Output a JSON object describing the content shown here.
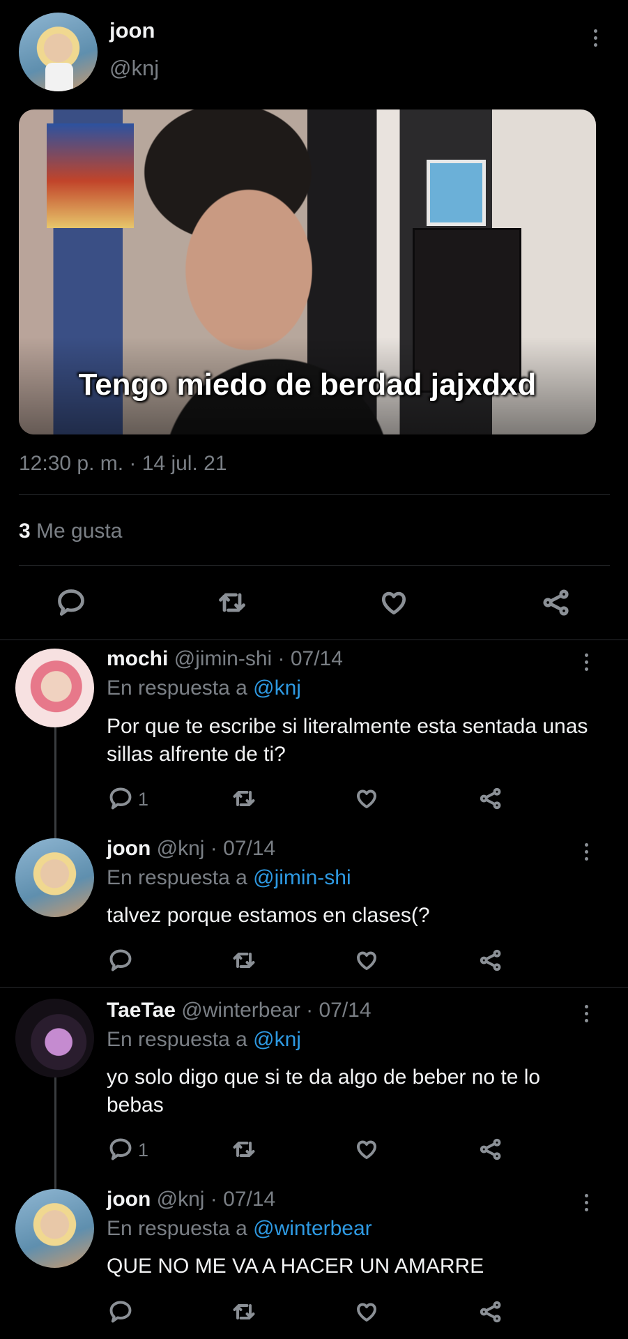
{
  "main_tweet": {
    "author_name": "joon",
    "author_handle": "@knj",
    "media_caption": "Tengo miedo de berdad jajxdxd",
    "timestamp": "12:30 p. m. · 14 jul. 21",
    "likes_count": "3",
    "likes_label": "Me gusta"
  },
  "replies": [
    {
      "name": "mochi",
      "handle_date": "@jimin-shi · 07/14",
      "reply_prefix": "En respuesta a",
      "reply_to": "@knj",
      "text": "Por que te escribe si literalmente esta sentada unas sillas alfrente de ti?",
      "reply_count": "1"
    },
    {
      "name": "joon",
      "handle_date": "@knj · 07/14",
      "reply_prefix": "En respuesta a",
      "reply_to": "@jimin-shi",
      "text": "talvez porque estamos en clases(?",
      "reply_count": ""
    },
    {
      "name": "TaeTae",
      "handle_date": "@winterbear · 07/14",
      "reply_prefix": "En respuesta a",
      "reply_to": "@knj",
      "text": "yo solo digo que si te da algo de beber no te lo bebas",
      "reply_count": "1"
    },
    {
      "name": "joon",
      "handle_date": "@knj · 07/14",
      "reply_prefix": "En respuesta a",
      "reply_to": "@winterbear",
      "text": "QUE NO ME VA A HACER UN AMARRE",
      "reply_count": ""
    }
  ],
  "colors": {
    "background": "#000000",
    "link": "#2e9ae3",
    "muted_text": "#7a7f85",
    "divider": "#2a2d30"
  },
  "icons": [
    "more-vertical-icon",
    "reply-icon",
    "retweet-icon",
    "like-icon",
    "share-icon"
  ]
}
